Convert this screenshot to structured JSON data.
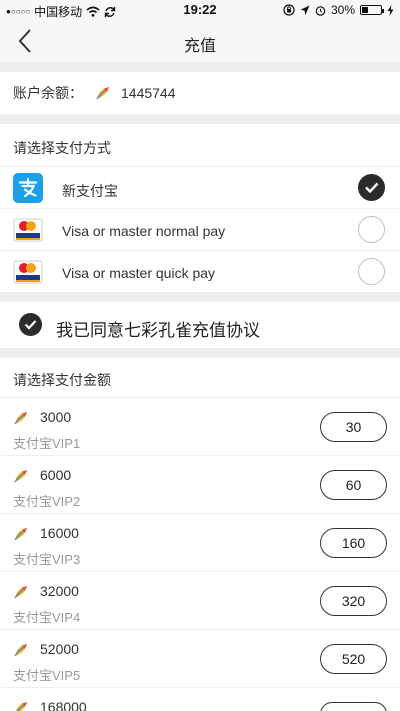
{
  "status_bar": {
    "carrier": "中国移动",
    "time": "19:22",
    "battery": "30%"
  },
  "nav": {
    "title": "充值"
  },
  "balance": {
    "label": "账户余额：",
    "value": "1445744"
  },
  "payment": {
    "section_label": "请选择支付方式",
    "methods": [
      {
        "label": "新支付宝",
        "icon": "alipay-icon",
        "selected": true
      },
      {
        "label": "Visa or master normal pay",
        "icon": "credit-card-icon",
        "selected": false
      },
      {
        "label": "Visa or master quick pay",
        "icon": "credit-card-icon",
        "selected": false
      }
    ]
  },
  "agreement": {
    "label": "我已同意七彩孔雀充值协议",
    "checked": true
  },
  "amounts": {
    "section_label": "请选择支付金额",
    "items": [
      {
        "coins": "3000",
        "vip": "支付宝VIP1",
        "price": "30"
      },
      {
        "coins": "6000",
        "vip": "支付宝VIP2",
        "price": "60"
      },
      {
        "coins": "16000",
        "vip": "支付宝VIP3",
        "price": "160"
      },
      {
        "coins": "32000",
        "vip": "支付宝VIP4",
        "price": "320"
      },
      {
        "coins": "52000",
        "vip": "支付宝VIP5",
        "price": "520"
      },
      {
        "coins": "168000",
        "vip": "",
        "price": ""
      }
    ]
  },
  "colors": {
    "alipay_blue": "#1a9fe8",
    "check_dark": "#2b2b2b",
    "gap_gray": "#ededed"
  }
}
